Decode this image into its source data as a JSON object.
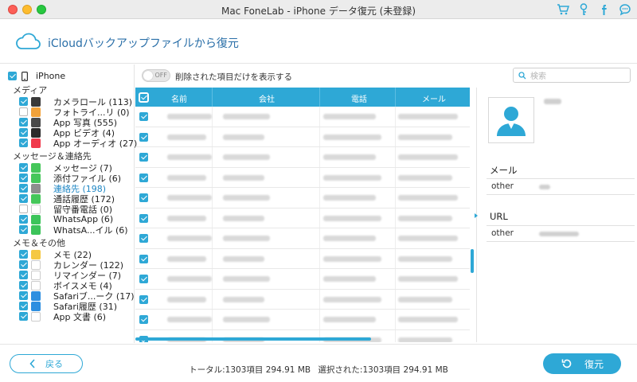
{
  "window": {
    "title": "Mac FoneLab - iPhone データ復元 (未登録)"
  },
  "toolbar_icons": [
    "cart-icon",
    "key-icon",
    "facebook-icon",
    "chat-icon"
  ],
  "header": {
    "title": "iCloudバックアップファイルから復元"
  },
  "sidebar": {
    "device": "iPhone",
    "categories": [
      {
        "title": "メディア",
        "items": [
          {
            "label": "カメラロール (113)",
            "checked": true,
            "icon": "camera-icon",
            "color": "#3a3a3a"
          },
          {
            "label": "フォトライ...リ (0)",
            "checked": false,
            "icon": "photos-icon",
            "color": "#f2a23a"
          },
          {
            "label": "App 写真 (555)",
            "checked": true,
            "icon": "app-photo-icon",
            "color": "#4a4a4a"
          },
          {
            "label": "App ビデオ (4)",
            "checked": true,
            "icon": "app-video-icon",
            "color": "#2b2b2b"
          },
          {
            "label": "App オーディオ (27)",
            "checked": true,
            "icon": "music-icon",
            "color": "#f03a4c"
          }
        ]
      },
      {
        "title": "メッセージ＆連絡先",
        "items": [
          {
            "label": "メッセージ (7)",
            "checked": true,
            "icon": "messages-icon",
            "color": "#45c75a"
          },
          {
            "label": "添付ファイル (6)",
            "checked": true,
            "icon": "attachment-icon",
            "color": "#45c75a"
          },
          {
            "label": "連絡先 (198)",
            "checked": true,
            "icon": "contacts-icon",
            "color": "#8e8e8e",
            "active": true
          },
          {
            "label": "通話履歴 (172)",
            "checked": true,
            "icon": "phone-icon",
            "color": "#45c75a"
          },
          {
            "label": "留守番電話 (0)",
            "checked": false,
            "icon": "voicemail-icon",
            "color": "#ffffff"
          },
          {
            "label": "WhatsApp (6)",
            "checked": true,
            "icon": "whatsapp-icon",
            "color": "#3cc45a"
          },
          {
            "label": "WhatsA...イル (6)",
            "checked": true,
            "icon": "whatsapp-file-icon",
            "color": "#3cc45a"
          }
        ]
      },
      {
        "title": "メモ＆その他",
        "items": [
          {
            "label": "メモ (22)",
            "checked": true,
            "icon": "notes-icon",
            "color": "#f5c842"
          },
          {
            "label": "カレンダー (122)",
            "checked": true,
            "icon": "calendar-icon",
            "color": "#ffffff"
          },
          {
            "label": "リマインダー (7)",
            "checked": true,
            "icon": "reminders-icon",
            "color": "#ffffff"
          },
          {
            "label": "ボイスメモ (4)",
            "checked": true,
            "icon": "voice-memo-icon",
            "color": "#ffffff"
          },
          {
            "label": "Safariブ...ーク (17)",
            "checked": true,
            "icon": "bookmark-icon",
            "color": "#2e8fe0"
          },
          {
            "label": "Safari履歴 (31)",
            "checked": true,
            "icon": "safari-icon",
            "color": "#2e8fe0"
          },
          {
            "label": "App 文書 (6)",
            "checked": true,
            "icon": "app-doc-icon",
            "color": "#ffffff"
          }
        ]
      }
    ]
  },
  "filter": {
    "toggle_text": "OFF",
    "label": "削除された項目だけを表示する",
    "search_placeholder": "検索"
  },
  "table": {
    "columns": [
      "名前",
      "会社",
      "電話",
      "メール"
    ],
    "rows": 12
  },
  "detail": {
    "mail_title": "メール",
    "mail_key": "other",
    "url_title": "URL",
    "url_key": "other"
  },
  "footer": {
    "back_label": "戻る",
    "total": "トータル:1303項目 294.91 MB",
    "selected": "選択された:1303項目 294.91 MB",
    "recover_label": "復元"
  },
  "colors": {
    "accent": "#2ea8d6",
    "active_text": "#1e86c4",
    "header_title": "#2a6fa8"
  }
}
